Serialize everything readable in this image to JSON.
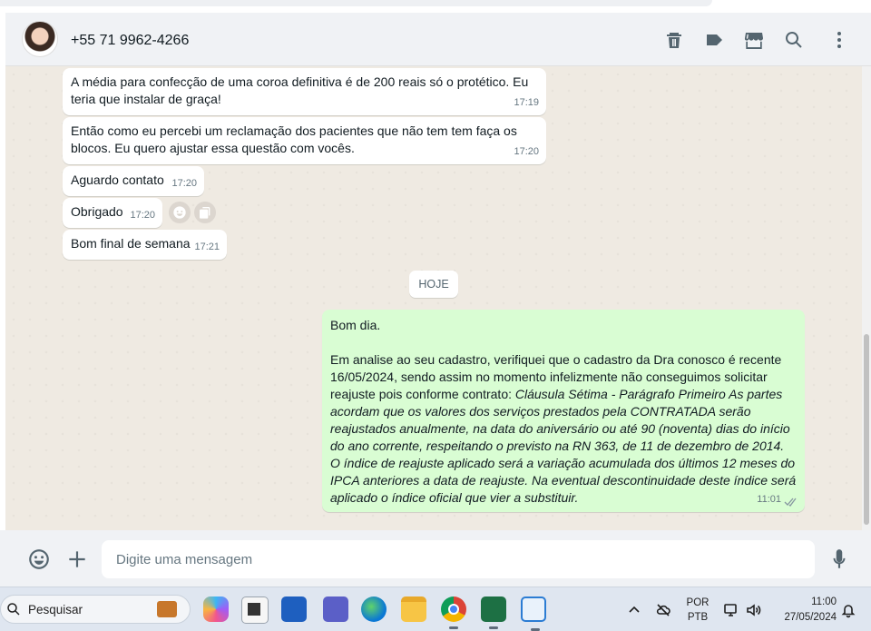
{
  "header": {
    "contact_name": "+55 71 9962-4266",
    "icons": [
      "trash-icon",
      "label-icon",
      "store-icon",
      "search-icon",
      "menu-icon"
    ]
  },
  "messages": [
    {
      "dir": "in",
      "text": "A média para confecção de uma coroa definitiva é de 200 reais só o protético. Eu teria que instalar de graça!",
      "time": "17:19"
    },
    {
      "dir": "in",
      "text": "Então como eu percebi um reclamação dos pacientes que não tem tem faça os blocos. Eu quero ajustar essa questão com vocês.",
      "time": "17:20"
    },
    {
      "dir": "in",
      "text": "Aguardo contato",
      "time": "17:20"
    },
    {
      "dir": "in",
      "text": "Obrigado",
      "time": "17:20"
    },
    {
      "dir": "in",
      "text": "Bom final de semana",
      "time": "17:21"
    }
  ],
  "date_divider": "HOJE",
  "outgoing": {
    "greeting": "Bom dia.",
    "para_start": "Em analise ao seu cadastro, verifiquei que o cadastro da Dra conosco é recente 16/05/2024, sendo assim no momento infelizmente não conseguimos solicitar reajuste pois conforme contrato: ",
    "para_italic": "Cláusula Sétima - Parágrafo Primeiro  As partes acordam que os valores dos serviços prestados pela CONTRATADA serão reajustados anualmente, na data do aniversário ou até 90 (noventa) dias do início do ano corrente, respeitando o previsto na RN 363, de 11 de dezembro de 2014. O índice de reajuste aplicado será a variação acumulada dos últimos 12 meses do IPCA anteriores a data de reajuste. Na eventual descontinuidade deste índice será aplicado o índice oficial que vier a substituir.",
    "time": "11:01",
    "status": "read-double-check"
  },
  "composer": {
    "placeholder": "Digite uma mensagem"
  },
  "taskbar": {
    "search_label": "Pesquisar",
    "apps": [
      "copilot-app",
      "file-explorer-app",
      "store-app",
      "teams-app",
      "edge-app",
      "folder-app",
      "chrome-app",
      "excel-app",
      "notepad-app"
    ],
    "lang_top": "POR",
    "lang_bottom": "PTB",
    "clock_time": "11:00",
    "clock_date": "27/05/2024"
  },
  "colors": {
    "chat_bg": "#efeae2",
    "incoming_bubble": "#ffffff",
    "outgoing_bubble": "#d9fdd3",
    "icon_gray": "#54656f",
    "read_tick": "#8696a0"
  }
}
